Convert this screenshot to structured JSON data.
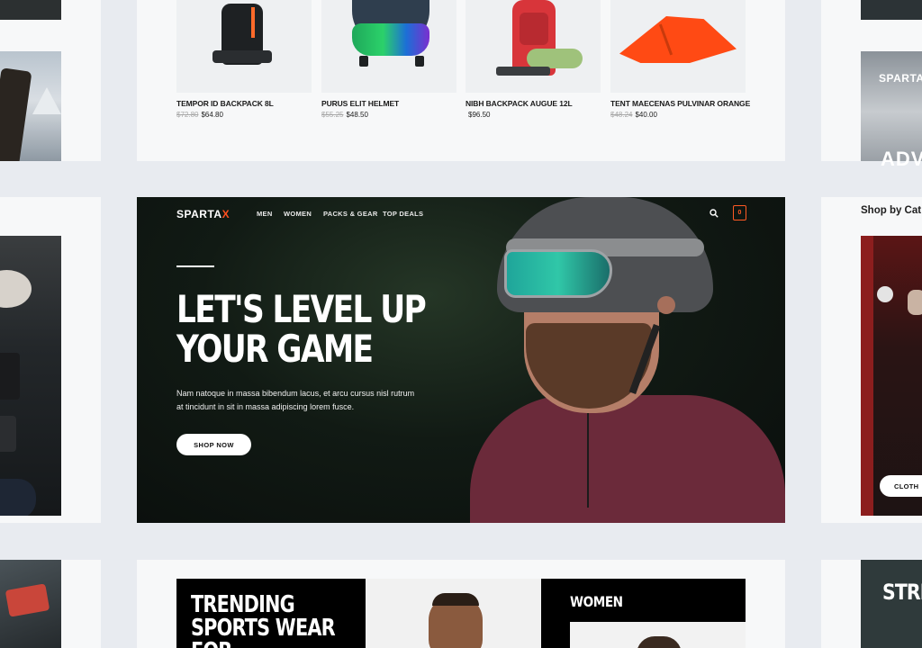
{
  "products": [
    {
      "name": "TEMPOR ID BACKPACK 8L",
      "old_price": "$72.80",
      "price": "$64.80"
    },
    {
      "name": "PURUS ELIT HELMET",
      "old_price": "$55.25",
      "price": "$48.50"
    },
    {
      "name": "NIBH BACKPACK AUGUE 12L",
      "old_price": "",
      "price": "$96.50"
    },
    {
      "name": "TENT MAECENAS PULVINAR ORANGE",
      "old_price": "$48.24",
      "price": "$40.00"
    }
  ],
  "hero": {
    "logo_main": "SPARTA",
    "logo_accent": "X",
    "nav": [
      "MEN",
      "WOMEN",
      "PACKS & GEAR",
      "TOP DEALS"
    ],
    "cart_count": "0",
    "title_line1": "LET'S LEVEL UP",
    "title_line2": "YOUR GAME",
    "copy": "Nam natoque in massa bibendum lacus, et arcu cursus nisl rutrum at tincidunt in sit in massa adipiscing lorem fusce.",
    "button": "SHOP NOW"
  },
  "right": {
    "logo": "SPARTA",
    "adv": "ADVE",
    "shop_by": "Shop by Cat",
    "clothing_btn": "CLOTH",
    "stre": "STRE"
  },
  "bottom": {
    "trend_line1": "TRENDING",
    "trend_line2": "SPORTS WEAR",
    "trend_line3": "FOR",
    "women": "WOMEN"
  },
  "colors": {
    "accent": "#ff4f1f",
    "background": "#e8ebf0",
    "card": "#f7f8f9"
  }
}
